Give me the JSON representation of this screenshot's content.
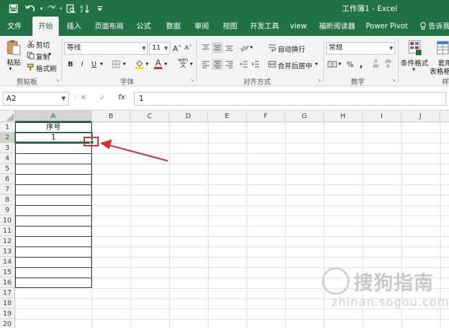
{
  "titlebar": {
    "title": "工作簿1 - Excel",
    "quick_access": [
      "save-icon",
      "undo-icon",
      "redo-icon",
      "print-preview-icon",
      "sort-icon",
      "customize-icon"
    ]
  },
  "tabs": [
    "文件",
    "开始",
    "插入",
    "页面布局",
    "公式",
    "数据",
    "审阅",
    "视图",
    "开发工具",
    "view",
    "福昕阅读器",
    "Power Pivot",
    "告诉我"
  ],
  "active_tab": "开始",
  "clipboard": {
    "paste": "粘贴",
    "cut": "剪切",
    "copy": "复制",
    "format_painter": "格式刷",
    "group_label": "剪贴板"
  },
  "font": {
    "name": "等线",
    "size": "11",
    "grow": "Aˆ",
    "shrink": "Aˇ",
    "bold": "B",
    "italic": "I",
    "underline": "U",
    "color_a": "A",
    "wen": "wén",
    "group_label": "字体"
  },
  "alignment": {
    "wrap": "自动换行",
    "merge": "合并后居中",
    "group_label": "对齐方式"
  },
  "number": {
    "format": "常规",
    "percent": "%",
    "comma": ",",
    "inc_decimal": ".0 .00",
    "dec_decimal": ".00 .0",
    "group_label": "数字"
  },
  "styles": {
    "conditional": "条件格式",
    "table_line1": "套用",
    "table_line2": "表格格",
    "group_label": "样"
  },
  "formula_bar": {
    "name_box": "A2",
    "cancel": "✕",
    "enter": "✓",
    "fx": "fx",
    "value": "1"
  },
  "grid": {
    "columns": [
      "A",
      "B",
      "C",
      "D",
      "E",
      "F",
      "G",
      "H",
      "I",
      "J"
    ],
    "rows": [
      "1",
      "2",
      "3",
      "4",
      "5",
      "6",
      "7",
      "8",
      "9",
      "10",
      "11",
      "12",
      "13",
      "14",
      "15",
      "16",
      "17",
      "18",
      "19",
      "20"
    ],
    "cells": {
      "A1": "序号",
      "A2": "1"
    },
    "selected_cell": "A2"
  },
  "watermark": {
    "text": "搜狗指南",
    "sub": "zhinan.sogou.com"
  },
  "colors": {
    "excel_green": "#217346",
    "annotation_red": "#e0292c"
  }
}
